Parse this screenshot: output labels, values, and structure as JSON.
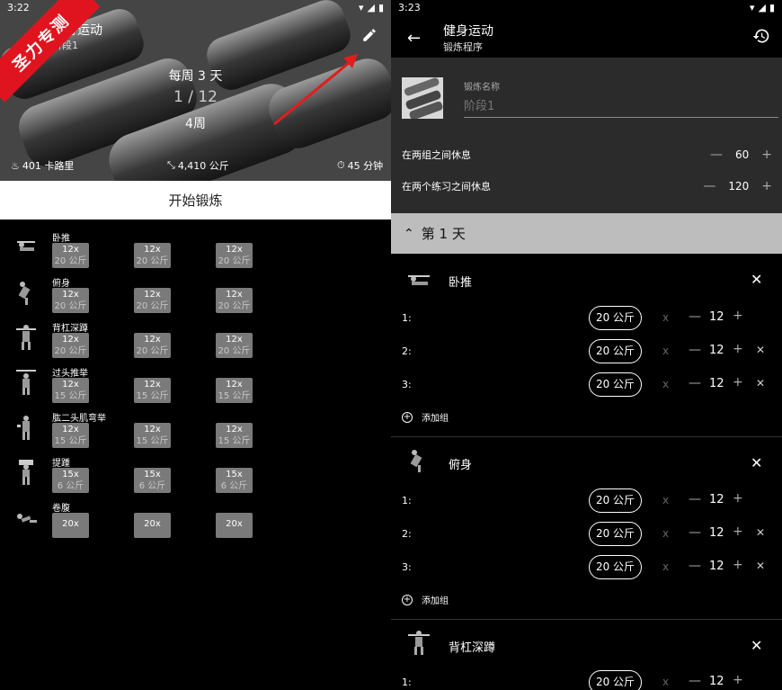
{
  "left": {
    "status_time": "3:22",
    "hero_title": "健身运动",
    "hero_subtitle": "阶段1",
    "badge": "圣力专测",
    "frequency": "每周 3 天",
    "progress": "1 / 12",
    "weeks": "4周",
    "stats": {
      "calories": "401 卡路里",
      "volume": "4,410 公斤",
      "duration": "45 分钟"
    },
    "start_button": "开始锻炼",
    "exercises": [
      {
        "name": "卧推",
        "sets": [
          {
            "reps": "12x",
            "weight": "20 公斤"
          },
          {
            "reps": "12x",
            "weight": "20 公斤"
          },
          {
            "reps": "12x",
            "weight": "20 公斤"
          }
        ]
      },
      {
        "name": "俯身",
        "sets": [
          {
            "reps": "12x",
            "weight": "20 公斤"
          },
          {
            "reps": "12x",
            "weight": "20 公斤"
          },
          {
            "reps": "12x",
            "weight": "20 公斤"
          }
        ]
      },
      {
        "name": "背杠深蹲",
        "sets": [
          {
            "reps": "12x",
            "weight": "20 公斤"
          },
          {
            "reps": "12x",
            "weight": "20 公斤"
          },
          {
            "reps": "12x",
            "weight": "20 公斤"
          }
        ]
      },
      {
        "name": "过头推举",
        "sets": [
          {
            "reps": "12x",
            "weight": "15 公斤"
          },
          {
            "reps": "12x",
            "weight": "15 公斤"
          },
          {
            "reps": "12x",
            "weight": "15 公斤"
          }
        ]
      },
      {
        "name": "肱二头肌弯举",
        "sets": [
          {
            "reps": "12x",
            "weight": "15 公斤"
          },
          {
            "reps": "12x",
            "weight": "15 公斤"
          },
          {
            "reps": "12x",
            "weight": "15 公斤"
          }
        ]
      },
      {
        "name": "提踵",
        "sets": [
          {
            "reps": "15x",
            "weight": "6 公斤"
          },
          {
            "reps": "15x",
            "weight": "6 公斤"
          },
          {
            "reps": "15x",
            "weight": "6 公斤"
          }
        ]
      },
      {
        "name": "卷腹",
        "sets": [
          {
            "reps": "20x",
            "weight": ""
          },
          {
            "reps": "20x",
            "weight": ""
          },
          {
            "reps": "20x",
            "weight": ""
          }
        ]
      }
    ]
  },
  "right": {
    "status_time": "3:23",
    "title": "健身运动",
    "subtitle": "锻炼程序",
    "workout_name_label": "锻炼名称",
    "workout_name_value": "阶段1",
    "rest_sets_label": "在两组之间休息",
    "rest_sets_value": "60",
    "rest_ex_label": "在两个练习之间休息",
    "rest_ex_value": "120",
    "day_label": "第 1 天",
    "add_set": "添加组",
    "blocks": [
      {
        "name": "卧推",
        "rows": [
          {
            "idx": "1:",
            "kg": "20 公斤",
            "reps": "12"
          },
          {
            "idx": "2:",
            "kg": "20 公斤",
            "reps": "12"
          },
          {
            "idx": "3:",
            "kg": "20 公斤",
            "reps": "12"
          }
        ]
      },
      {
        "name": "俯身",
        "rows": [
          {
            "idx": "1:",
            "kg": "20 公斤",
            "reps": "12"
          },
          {
            "idx": "2:",
            "kg": "20 公斤",
            "reps": "12"
          },
          {
            "idx": "3:",
            "kg": "20 公斤",
            "reps": "12"
          }
        ]
      },
      {
        "name": "背杠深蹲",
        "rows": [
          {
            "idx": "1:",
            "kg": "20 公斤",
            "reps": "12"
          }
        ]
      }
    ],
    "x_symbol": "x"
  }
}
